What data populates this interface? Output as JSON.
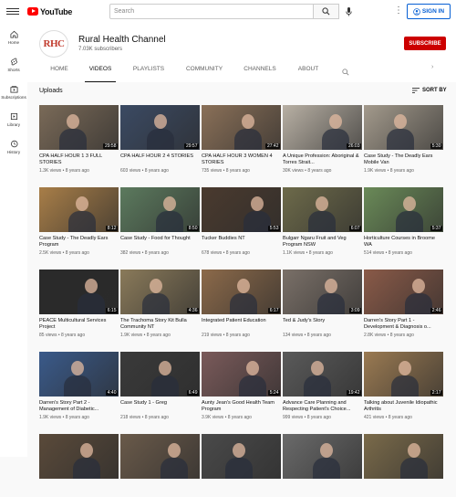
{
  "masthead": {
    "logo_text": "YouTube",
    "search_placeholder": "Search",
    "signin_label": "SIGN IN"
  },
  "guide": [
    {
      "icon": "home-icon",
      "label": "Home"
    },
    {
      "icon": "shorts-icon",
      "label": "Shorts"
    },
    {
      "icon": "subscriptions-icon",
      "label": "Subscriptions"
    },
    {
      "icon": "library-icon",
      "label": "Library"
    },
    {
      "icon": "history-icon",
      "label": "History"
    }
  ],
  "channel": {
    "avatar_text": "RHC",
    "name": "Rural Health Channel",
    "subscribers": "7.03K subscribers",
    "subscribe_label": "SUBSCRIBE",
    "accent": "#cc0000"
  },
  "tabs": [
    "HOME",
    "VIDEOS",
    "PLAYLISTS",
    "COMMUNITY",
    "CHANNELS",
    "ABOUT"
  ],
  "section": {
    "title": "Uploads",
    "sort_label": "SORT BY"
  },
  "videos": [
    {
      "title": "CPA HALF HOUR 1 3 FULL STORIES",
      "views": "1.3K views",
      "age": "8 years ago",
      "duration": "29:58",
      "bg": "#7a6a58"
    },
    {
      "title": "CPA HALF HOUR 2 4 STORIES",
      "views": "603 views",
      "age": "8 years ago",
      "duration": "29:57",
      "bg": "#3b4a63"
    },
    {
      "title": "CPA HALF HOUR 3 WOMEN 4 STORIES",
      "views": "735 views",
      "age": "8 years ago",
      "duration": "27:42",
      "bg": "#8a7058"
    },
    {
      "title": "A Unique Profession: Aboriginal & Torres Strait...",
      "views": "30K views",
      "age": "8 years ago",
      "duration": "26:03",
      "bg": "#b8b0a4"
    },
    {
      "title": "Case Study - The Deadly Ears Mobile Van",
      "views": "1.9K views",
      "age": "8 years ago",
      "duration": "5:30",
      "bg": "#a39a8c"
    },
    {
      "title": "Case Study - The Deadly Ears Program",
      "views": "2.5K views",
      "age": "8 years ago",
      "duration": "8:12",
      "bg": "#a87e48"
    },
    {
      "title": "Case Study - Food for Thought",
      "views": "382 views",
      "age": "8 years ago",
      "duration": "8:50",
      "bg": "#5c7a5e"
    },
    {
      "title": "Tucker Buddies NT",
      "views": "678 views",
      "age": "8 years ago",
      "duration": "5:53",
      "bg": "#4a3a2e"
    },
    {
      "title": "Bulgarr Ngaru Fruit and Veg Program NSW",
      "views": "1.1K views",
      "age": "8 years ago",
      "duration": "6:07",
      "bg": "#6d6a4a"
    },
    {
      "title": "Horticulture Courses in Broome WA",
      "views": "514 views",
      "age": "8 years ago",
      "duration": "5:37",
      "bg": "#6a8a58"
    },
    {
      "title": "PEACE Multicultural Services Project",
      "views": "85 views",
      "age": "8 years ago",
      "duration": "6:15",
      "bg": "#2a2a2a"
    },
    {
      "title": "The Trachoma Story Kit Bulla Community NT",
      "views": "1.9K views",
      "age": "8 years ago",
      "duration": "4:36",
      "bg": "#8a7a5a"
    },
    {
      "title": "Integrated Patient Education",
      "views": "219 views",
      "age": "8 years ago",
      "duration": "6:17",
      "bg": "#8c6a4a"
    },
    {
      "title": "Ted & Judy's Story",
      "views": "134 views",
      "age": "8 years ago",
      "duration": "3:09",
      "bg": "#7a7068"
    },
    {
      "title": "Darren's Story Part 1 - Development & Diagnosis o...",
      "views": "2.8K views",
      "age": "8 years ago",
      "duration": "2:46",
      "bg": "#8a5a48"
    },
    {
      "title": "Darren's Story Part 2 - Management of Diabetic...",
      "views": "1.9K views",
      "age": "8 years ago",
      "duration": "4:40",
      "bg": "#3a5a8a"
    },
    {
      "title": "Case Study 1 - Greg",
      "views": "218 views",
      "age": "8 years ago",
      "duration": "6:49",
      "bg": "#3a3a3a"
    },
    {
      "title": "Aunty Jean's Good Health Team Program",
      "views": "3.9K views",
      "age": "8 years ago",
      "duration": "5:24",
      "bg": "#7a5a5a"
    },
    {
      "title": "Advance Care Planning and Respecting Patient's Choice...",
      "views": "999 views",
      "age": "8 years ago",
      "duration": "19:42",
      "bg": "#5a5a5a"
    },
    {
      "title": "Talking about Juvenile Idiopathic Arthritis",
      "views": "421 views",
      "age": "8 years ago",
      "duration": "2:17",
      "bg": "#9a7a52"
    },
    {
      "title": "",
      "views": "",
      "age": "",
      "duration": "",
      "bg": "#5a4a3a"
    },
    {
      "title": "",
      "views": "",
      "age": "",
      "duration": "",
      "bg": "#6a5a4a"
    },
    {
      "title": "",
      "views": "",
      "age": "",
      "duration": "",
      "bg": "#4a4a4a"
    },
    {
      "title": "",
      "views": "",
      "age": "",
      "duration": "",
      "bg": "#6a6a6a"
    },
    {
      "title": "",
      "views": "",
      "age": "",
      "duration": "",
      "bg": "#7a6a4a"
    }
  ]
}
